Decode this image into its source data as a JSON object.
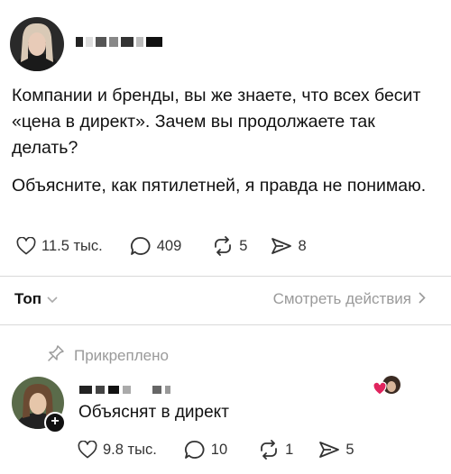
{
  "post": {
    "paragraphs": [
      "Компании и бренды, вы же знаете, что всех бесит «цена в директ». Зачем вы продолжаете так делать?",
      "Объясните, как пятилетней, я правда не понимаю."
    ],
    "likes": "11.5 тыс.",
    "comments": "409",
    "reposts": "5",
    "shares": "8"
  },
  "replies_bar": {
    "sort_label": "Топ",
    "view_activity_label": "Смотреть действия"
  },
  "reply": {
    "pinned_label": "Прикреплено",
    "text": "Объяснят в директ",
    "likes": "9.8 тыс.",
    "comments": "10",
    "reposts": "1",
    "shares": "5"
  },
  "icons": {
    "like": "heart-icon",
    "comment": "comment-bubble-icon",
    "repost": "repost-arrows-icon",
    "share": "send-icon",
    "pin": "pin-icon",
    "follow": "plus-icon"
  },
  "colors": {
    "text": "#111111",
    "muted": "#9a9a9a",
    "liked_heart": "#e0245e"
  }
}
